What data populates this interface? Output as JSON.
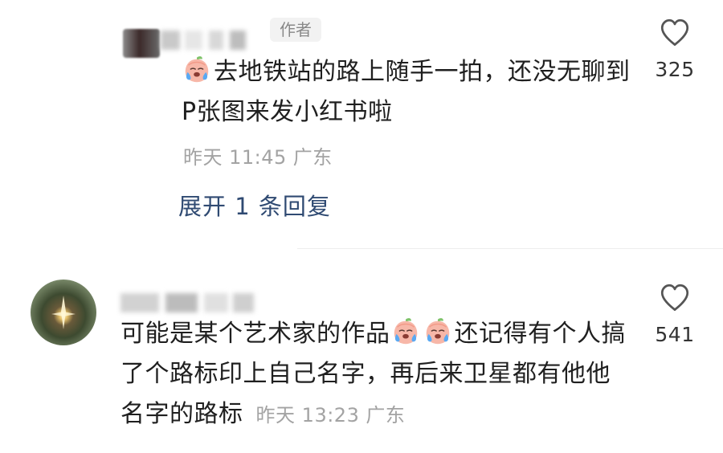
{
  "comments": [
    {
      "author_badge": "作者",
      "text": "去地铁站的路上随手一拍，还没无聊到P张图来发小红书啦",
      "emoji": "crying-face-emoji",
      "time": "昨天 11:45",
      "location": "广东",
      "expand_label": "展开 1 条回复",
      "likes": "325"
    },
    {
      "text_after_emoji": "还记得有个人搞了个路标印上自己名字，再后来卫星都有他他名字的路标",
      "text_before_emoji": "可能是某个艺术家的作品",
      "emoji": "crying-face-emoji",
      "time": "昨天 13:23",
      "location": "广东",
      "likes": "541"
    }
  ],
  "colors": {
    "link": "#2f4a72",
    "meta": "#a3a3a3",
    "text": "#1f1f1f"
  },
  "icons": {
    "like": "heart-outline-icon",
    "emoji": "crying-face-emoji"
  }
}
